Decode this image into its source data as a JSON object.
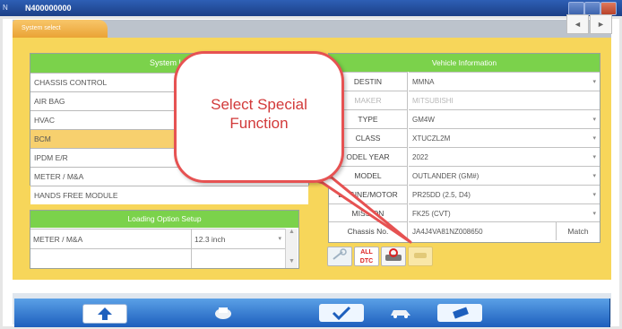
{
  "window": {
    "title": "N400000000",
    "logo_text": "N"
  },
  "tabs": {
    "active": "System select",
    "prev": "◄",
    "next": "►"
  },
  "system_list": {
    "header": "System Lis",
    "items": [
      "CHASSIS CONTROL",
      "AIR BAG",
      "HVAC",
      "BCM",
      "IPDM E/R",
      "METER / M&A",
      "HANDS FREE MODULE"
    ],
    "selected_index": 3
  },
  "loading_option": {
    "header": "Loading Option Setup",
    "rows": [
      {
        "name": "METER / M&A",
        "value": "12.3 inch"
      },
      {
        "name": "",
        "value": ""
      }
    ],
    "scroll_up": "▲",
    "scroll_down": "▼"
  },
  "vehicle_info": {
    "header": "Vehicle Information",
    "rows": [
      {
        "label": "DESTIN",
        "value": "MMNA"
      },
      {
        "label": "MAKER",
        "value": "MITSUBISHI"
      },
      {
        "label": "TYPE",
        "value": "GM4W"
      },
      {
        "label": "CLASS",
        "value": "XTUCZL2M"
      },
      {
        "label": "ODEL YEAR",
        "value": "2022"
      },
      {
        "label": "MODEL",
        "value": "OUTLANDER (GM#)"
      },
      {
        "label": "ENGINE/MOTOR",
        "value": "PR25DD (2.5, D4)"
      },
      {
        "label": "MISSION",
        "value": "FK25 (CVT)"
      },
      {
        "label": "Chassis No.",
        "value": "JA4J4VA81NZ008650"
      }
    ],
    "match_label": "Match",
    "caret": "▾"
  },
  "icons": {
    "all_dtc_top": "ALL",
    "all_dtc_bottom": "DTC"
  },
  "callout": {
    "line1": "Select Special",
    "line2": "Function"
  }
}
